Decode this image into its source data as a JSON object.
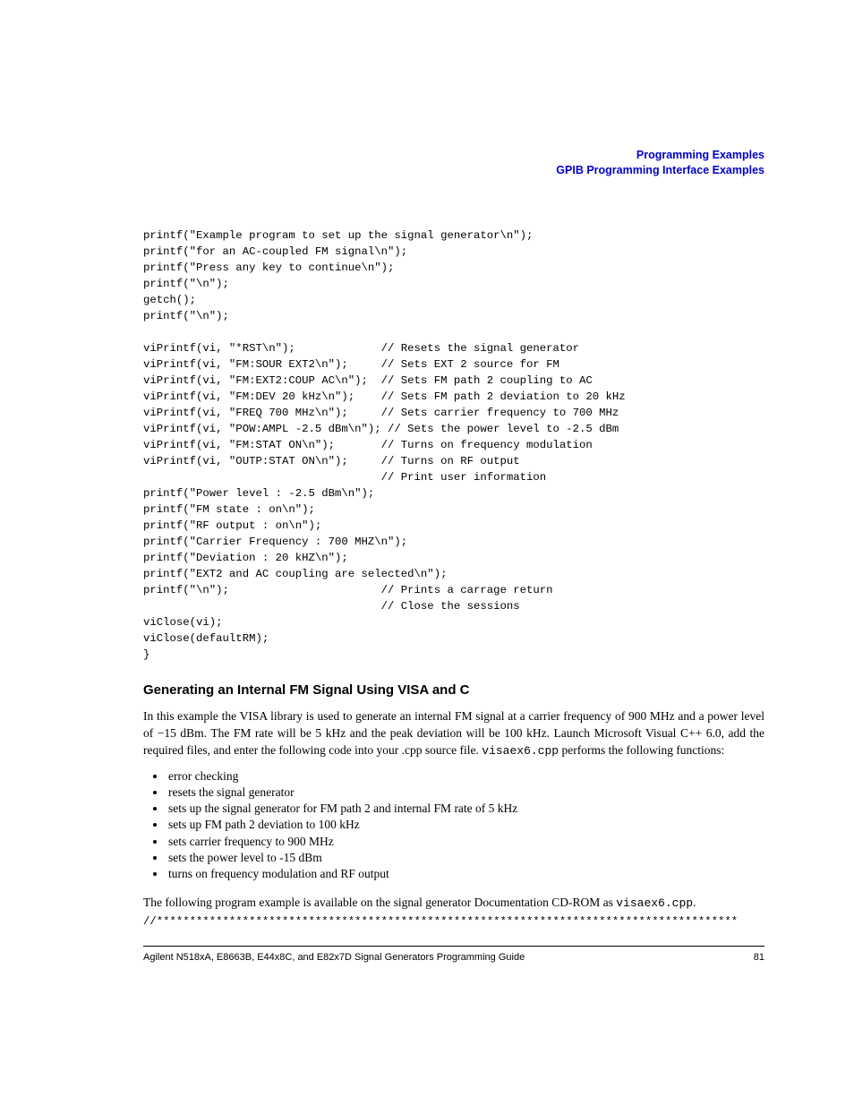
{
  "header": {
    "line1": "Programming Examples",
    "line2": "GPIB Programming Interface Examples"
  },
  "code_block": "printf(\"Example program to set up the signal generator\\n\");\nprintf(\"for an AC-coupled FM signal\\n\");\nprintf(\"Press any key to continue\\n\");\nprintf(\"\\n\");\ngetch();\nprintf(\"\\n\");\n\nviPrintf(vi, \"*RST\\n\");             // Resets the signal generator \nviPrintf(vi, \"FM:SOUR EXT2\\n\");     // Sets EXT 2 source for FM\nviPrintf(vi, \"FM:EXT2:COUP AC\\n\");  // Sets FM path 2 coupling to AC\nviPrintf(vi, \"FM:DEV 20 kHz\\n\");    // Sets FM path 2 deviation to 20 kHz\nviPrintf(vi, \"FREQ 700 MHz\\n\");     // Sets carrier frequency to 700 MHz\nviPrintf(vi, \"POW:AMPL -2.5 dBm\\n\"); // Sets the power level to -2.5 dBm\nviPrintf(vi, \"FM:STAT ON\\n\");       // Turns on frequency modulation\nviPrintf(vi, \"OUTP:STAT ON\\n\");     // Turns on RF output\n                                    // Print user information \nprintf(\"Power level : -2.5 dBm\\n\");\nprintf(\"FM state : on\\n\");\nprintf(\"RF output : on\\n\");\nprintf(\"Carrier Frequency : 700 MHZ\\n\");\nprintf(\"Deviation : 20 kHZ\\n\");\nprintf(\"EXT2 and AC coupling are selected\\n\");\nprintf(\"\\n\");                       // Prints a carrage return\n                                    // Close the sessions\nviClose(vi);\nviClose(defaultRM);\n}",
  "section_heading": "Generating an Internal FM Signal Using VISA and C",
  "para1_a": "In this example the VISA library is used to generate an internal FM signal at a carrier frequency of 900 MHz and a power level of −15 dBm. The FM rate will be 5 kHz and the peak deviation will be 100 kHz. Launch Microsoft Visual C++ 6.0, add the required files, and enter the following code into your .cpp source file. ",
  "para1_mono": "visaex6.cpp",
  "para1_b": " performs the following functions:",
  "bullets": [
    "error checking",
    "resets the signal generator",
    "sets up the signal generator for FM path 2 and internal FM rate of 5 kHz",
    "sets up FM path 2 deviation to 100 kHz",
    "sets carrier frequency to 900 MHz",
    "sets the power level to -15 dBm",
    "turns on frequency modulation and RF output"
  ],
  "para2_a": "The following program example is available on the signal generator Documentation CD-ROM as ",
  "para2_mono": "visaex6.cpp",
  "para2_b": ".",
  "code_divider": "//****************************************************************************************",
  "footer": {
    "left": "Agilent N518xA, E8663B, E44x8C, and E82x7D Signal Generators Programming Guide",
    "right": "81"
  }
}
